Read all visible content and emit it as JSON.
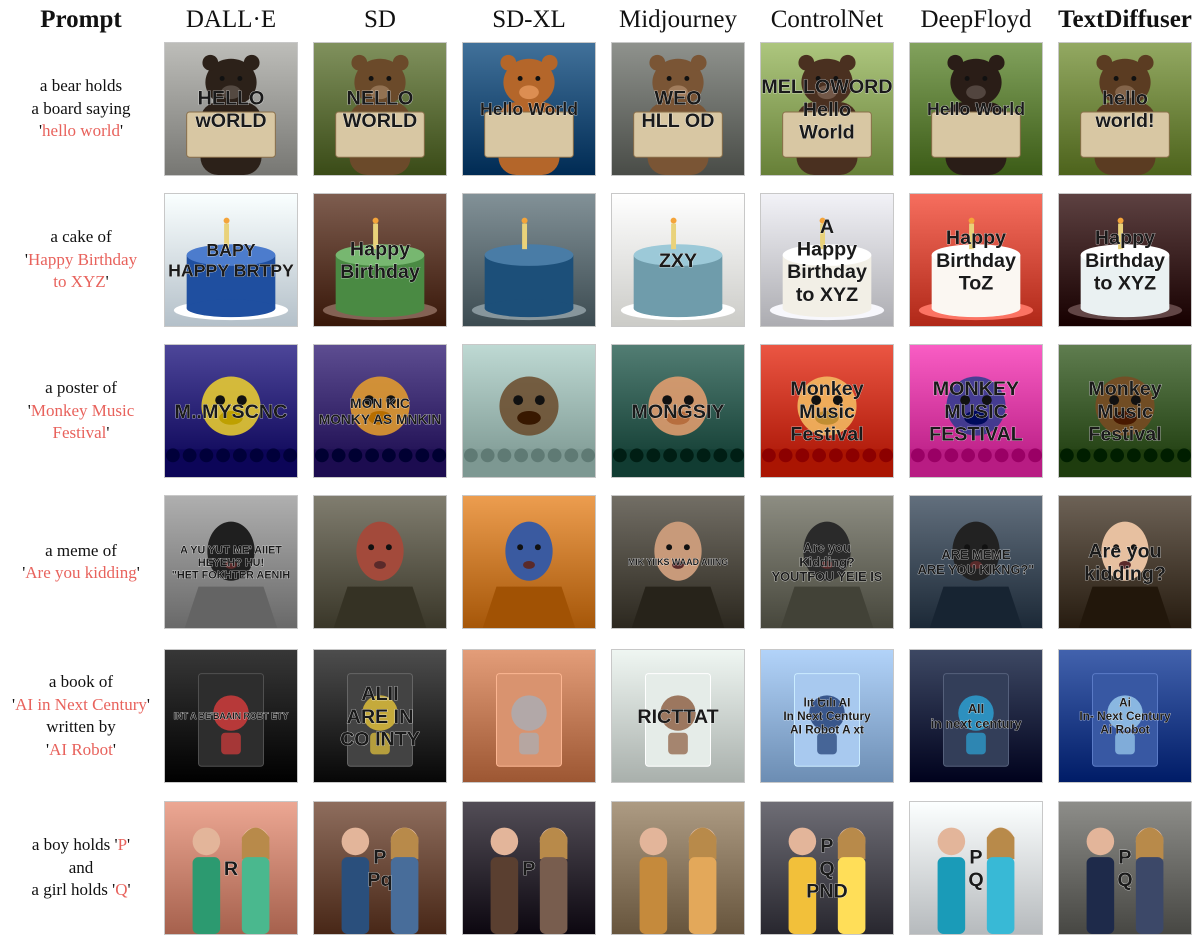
{
  "header": {
    "prompt_label": "Prompt",
    "models": [
      "DALL·E",
      "SD",
      "SD-XL",
      "Midjourney",
      "ControlNet",
      "DeepFloyd",
      "TextDiffuser"
    ]
  },
  "rows": [
    {
      "prompt_parts": [
        {
          "t": "a bear holds",
          "hl": false
        },
        {
          "t": "a board saying",
          "hl": false
        },
        {
          "t": "'",
          "hl": false,
          "join": true
        },
        {
          "t": "hello world",
          "hl": true,
          "join": true
        },
        {
          "t": "'",
          "hl": false
        }
      ],
      "cells": [
        {
          "subject": "bear",
          "text": [
            "HELLO",
            "wORLD"
          ],
          "bg": "#9a9a96",
          "fg": "#2c2119"
        },
        {
          "subject": "bear",
          "text": [
            "NELLO",
            "WORLD"
          ],
          "bg": "#5d6e3a",
          "fg": "#6b4a2a"
        },
        {
          "subject": "bear",
          "text": [
            "Hello World"
          ],
          "bg": "#1e4e77",
          "fg": "#b4662a"
        },
        {
          "subject": "bear",
          "text": [
            "WEO",
            "HLL OD"
          ],
          "bg": "#6c6f6a",
          "fg": "#7a5535"
        },
        {
          "subject": "bear",
          "text": [
            "MELLOWORD",
            "Hello",
            "World"
          ],
          "bg": "#8aa35b",
          "fg": "#4a3020"
        },
        {
          "subject": "bear",
          "text": [
            "Hello World"
          ],
          "bg": "#5f7f3a",
          "fg": "#2a1d17"
        },
        {
          "subject": "bear",
          "text": [
            "hello",
            "world!"
          ],
          "bg": "#70863f",
          "fg": "#5b3c22"
        }
      ]
    },
    {
      "prompt_parts": [
        {
          "t": "a cake of",
          "hl": false
        },
        {
          "t": "'",
          "hl": false,
          "join": true
        },
        {
          "t": "Happy Birthday",
          "hl": true
        },
        {
          "t": "to XYZ",
          "hl": true,
          "join": true
        },
        {
          "t": "'",
          "hl": false
        }
      ],
      "cells": [
        {
          "subject": "cake",
          "text": [
            "BAPY",
            "HAPPY BRTPY"
          ],
          "bg": "#d7e3ec",
          "fg": "#1f4fa0"
        },
        {
          "subject": "cake",
          "text": [
            "Happy",
            "Birthday"
          ],
          "bg": "#5b3a2c",
          "fg": "#4a8a43"
        },
        {
          "subject": "cake",
          "text": [],
          "bg": "#5f6e74",
          "fg": "#1c4f79"
        },
        {
          "subject": "cake",
          "text": [
            "ZXY"
          ],
          "bg": "#eeeeea",
          "fg": "#6f9cab"
        },
        {
          "subject": "cake",
          "text": [
            "A",
            "Happy",
            "Birthday",
            "to XYZ"
          ],
          "bg": "#cfcfd4",
          "fg": "#f2efe6"
        },
        {
          "subject": "cake",
          "text": [
            "Happy",
            "Birthday",
            "ToZ"
          ],
          "bg": "#d34b3b",
          "fg": "#fbf7f2"
        },
        {
          "subject": "cake",
          "text": [
            "Happy",
            "Birthday",
            "to XYZ"
          ],
          "bg": "#3a1e1e",
          "fg": "#eaf1f2"
        }
      ]
    },
    {
      "prompt_parts": [
        {
          "t": "a poster of",
          "hl": false
        },
        {
          "t": "'",
          "hl": false,
          "join": true
        },
        {
          "t": "Monkey Music",
          "hl": true
        },
        {
          "t": "Festival",
          "hl": true,
          "join": true
        },
        {
          "t": "'",
          "hl": false
        }
      ],
      "cells": [
        {
          "subject": "poster",
          "text": [
            "M..MYSCNC"
          ],
          "bg": "#2a2376",
          "fg": "#f0d22e"
        },
        {
          "subject": "poster",
          "text": [
            "MON KIC",
            "MONKY AS MNKIN"
          ],
          "bg": "#3a2a6e",
          "fg": "#e9a02c"
        },
        {
          "subject": "poster",
          "text": [],
          "bg": "#9bb6b0",
          "fg": "#6a4a2a"
        },
        {
          "subject": "poster",
          "text": [
            "MONGSIY"
          ],
          "bg": "#2f5a50",
          "fg": "#e9a070"
        },
        {
          "subject": "poster",
          "text": [
            "Monkey",
            "Music",
            "Festival"
          ],
          "bg": "#c83320",
          "fg": "#f4c064"
        },
        {
          "subject": "poster",
          "text": [
            "MONKEY",
            "MUSIC",
            "FESTIVAL"
          ],
          "bg": "#d63aa1",
          "fg": "#2a3c8e"
        },
        {
          "subject": "poster",
          "text": [
            "Monkey",
            "Music",
            "Festival"
          ],
          "bg": "#3c5a2c",
          "fg": "#7a4a22"
        }
      ]
    },
    {
      "prompt_parts": [
        {
          "t": "a meme of",
          "hl": false
        },
        {
          "t": "'",
          "hl": false,
          "join": true
        },
        {
          "t": "Are you kidding",
          "hl": true,
          "join": true
        },
        {
          "t": "'",
          "hl": false
        }
      ],
      "cells": [
        {
          "subject": "meme",
          "text": [
            "A YU YUT ME' AIIET",
            "HEYEH? HU!",
            "\"HET FOKHTER AENIH"
          ],
          "bg": "#8c8c8c",
          "fg": "#1f1f1f"
        },
        {
          "subject": "meme",
          "text": [],
          "bg": "#5d5a4c",
          "fg": "#a34a3b"
        },
        {
          "subject": "meme",
          "text": [],
          "bg": "#c97a2c",
          "fg": "#3a5aa0"
        },
        {
          "subject": "meme",
          "text": [
            "MIK YIIKS WAAD AIIING"
          ],
          "bg": "#4f4b42",
          "fg": "#c89a7a"
        },
        {
          "subject": "meme",
          "text": [
            "Are you",
            "Kidding?",
            "YOUTFOU YEIE IS"
          ],
          "bg": "#6a6a5f",
          "fg": "#2a2a2a"
        },
        {
          "subject": "meme",
          "text": [
            "ARE MEME",
            "ARE YOU KIKNG?\""
          ],
          "bg": "#3f4c5a",
          "fg": "#222"
        },
        {
          "subject": "meme",
          "text": [
            "Are you",
            "kidding?"
          ],
          "bg": "#4a3f33",
          "fg": "#e7c0a0"
        }
      ]
    },
    {
      "prompt_parts": [
        {
          "t": "a book of",
          "hl": false
        },
        {
          "t": "'",
          "hl": false,
          "join": true
        },
        {
          "t": "AI in Next Century",
          "hl": true,
          "join": true
        },
        {
          "t": "'",
          "hl": false
        },
        {
          "t": "written by",
          "hl": false
        },
        {
          "t": "'",
          "hl": false,
          "join": true
        },
        {
          "t": "AI Robot",
          "hl": true,
          "join": true
        },
        {
          "t": "'",
          "hl": false
        }
      ],
      "cells": [
        {
          "subject": "book",
          "text": [
            "INT A BE'BAAIN ROBT ETY"
          ],
          "bg": "#141414",
          "fg": "#d93c3c"
        },
        {
          "subject": "book",
          "text": [
            "ALII",
            "ARE IN",
            "CO INTY"
          ],
          "bg": "#2a2a2a",
          "fg": "#e6c43a"
        },
        {
          "subject": "book",
          "text": [],
          "bg": "#c07a56",
          "fg": "#a7aeb6"
        },
        {
          "subject": "book",
          "text": [
            "RICTTAT"
          ],
          "bg": "#ccd3cf",
          "fg": "#8a5a3c"
        },
        {
          "subject": "book",
          "text": [
            "lıt Եılı  AI",
            "In  Next  Century",
            "AI  Robot  A xt"
          ],
          "bg": "#8fb0d6",
          "fg": "#1d3a72"
        },
        {
          "subject": "book",
          "text": [
            "AII",
            "in next century"
          ],
          "bg": "#1a2540",
          "fg": "#2ca5d8"
        },
        {
          "subject": "book",
          "text": [
            "Ai",
            "In- Next  Century",
            "Ai  Robot"
          ],
          "bg": "#1f3f8a",
          "fg": "#9fd0f0"
        }
      ]
    },
    {
      "prompt_parts": [
        {
          "t": "a boy holds '",
          "hl": false,
          "join": true
        },
        {
          "t": "P",
          "hl": true,
          "join": true
        },
        {
          "t": "'",
          "hl": false
        },
        {
          "t": "and",
          "hl": false
        },
        {
          "t": "a girl holds '",
          "hl": false,
          "join": true
        },
        {
          "t": "Q",
          "hl": true,
          "join": true
        },
        {
          "t": "'",
          "hl": false
        }
      ],
      "cells": [
        {
          "subject": "kids",
          "text": [
            "R"
          ],
          "bg": "#c98470",
          "fg": "#2c9a70"
        },
        {
          "subject": "kids",
          "text": [
            "P",
            "Pq"
          ],
          "bg": "#6b4a3a",
          "fg": "#2a4f7c"
        },
        {
          "subject": "kids",
          "text": [
            "P"
          ],
          "bg": "#2f2a33",
          "fg": "#5a3f30"
        },
        {
          "subject": "kids",
          "text": [],
          "bg": "#8a7860",
          "fg": "#c58a3c"
        },
        {
          "subject": "kids",
          "text": [
            "P",
            "Q",
            "PND"
          ],
          "bg": "#4b4a52",
          "fg": "#f2c03a"
        },
        {
          "subject": "kids",
          "text": [
            "P",
            "Q"
          ],
          "bg": "#d9dde0",
          "fg": "#1a9bb8"
        },
        {
          "subject": "kids",
          "text": [
            "P",
            "Q"
          ],
          "bg": "#6a6a66",
          "fg": "#1e2a4a"
        }
      ]
    }
  ]
}
